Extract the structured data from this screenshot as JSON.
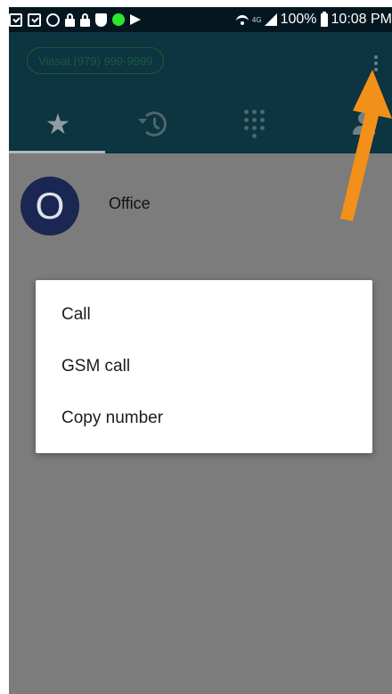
{
  "status_bar": {
    "battery_percent": "100%",
    "time": "10:08 PM",
    "network_type": "4G",
    "left_icons": [
      "check-box-icon",
      "image-icon",
      "globe-icon",
      "lock-icon",
      "lock-warning-icon",
      "shield-icon",
      "green-dot-icon",
      "flag-icon"
    ]
  },
  "app_bar": {
    "sim_label": "Viasat (979) 999-9999",
    "overflow_icon": "more-vert-icon",
    "tabs": [
      {
        "id": "favorites",
        "icon": "star-icon",
        "selected": true
      },
      {
        "id": "recents",
        "icon": "history-icon",
        "selected": false
      },
      {
        "id": "keypad",
        "icon": "dialpad-icon",
        "selected": false
      },
      {
        "id": "contacts",
        "icon": "person-icon",
        "selected": false
      }
    ]
  },
  "contact": {
    "initial": "O",
    "name": "Office"
  },
  "dialog": {
    "items": [
      {
        "label": "Call"
      },
      {
        "label": "GSM call"
      },
      {
        "label": "Copy number"
      }
    ]
  },
  "colors": {
    "app_bar": "#0c3441",
    "status_bar": "#04161f",
    "avatar": "#1a2753",
    "annotation_arrow": "#f39019",
    "scrim_content": "#7c7c7c"
  }
}
